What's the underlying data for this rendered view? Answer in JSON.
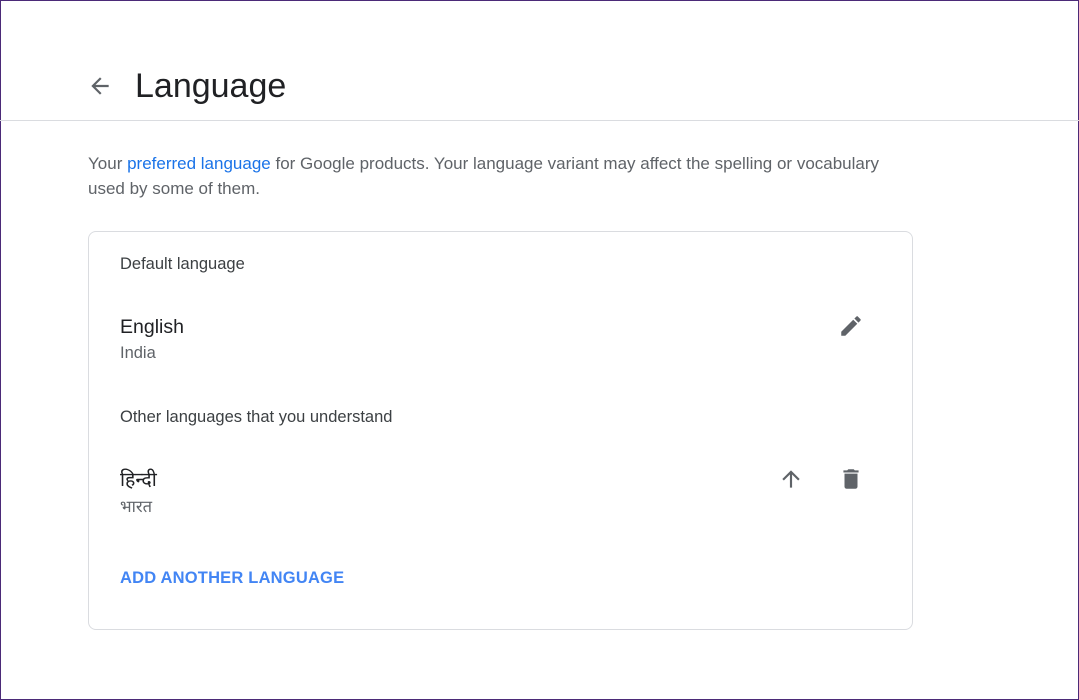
{
  "header": {
    "title": "Language",
    "back_icon": "arrow-left-icon"
  },
  "intro": {
    "prefix": "Your ",
    "link_text": "preferred language",
    "suffix": " for Google products. Your language variant may affect the spelling or vocabulary used by some of them."
  },
  "card": {
    "default_section_label": "Default language",
    "default_language": {
      "name": "English",
      "region": "India",
      "edit_icon": "pencil-icon"
    },
    "other_section_label": "Other languages that you understand",
    "other_languages": [
      {
        "name": "हिन्दी",
        "region": "भारत",
        "move_up_icon": "arrow-up-icon",
        "delete_icon": "trash-icon"
      }
    ],
    "add_button_label": "ADD ANOTHER LANGUAGE"
  },
  "colors": {
    "link": "#1a73e8",
    "action": "#4285f4",
    "icon": "#5f6368",
    "divider": "#dadce0"
  }
}
